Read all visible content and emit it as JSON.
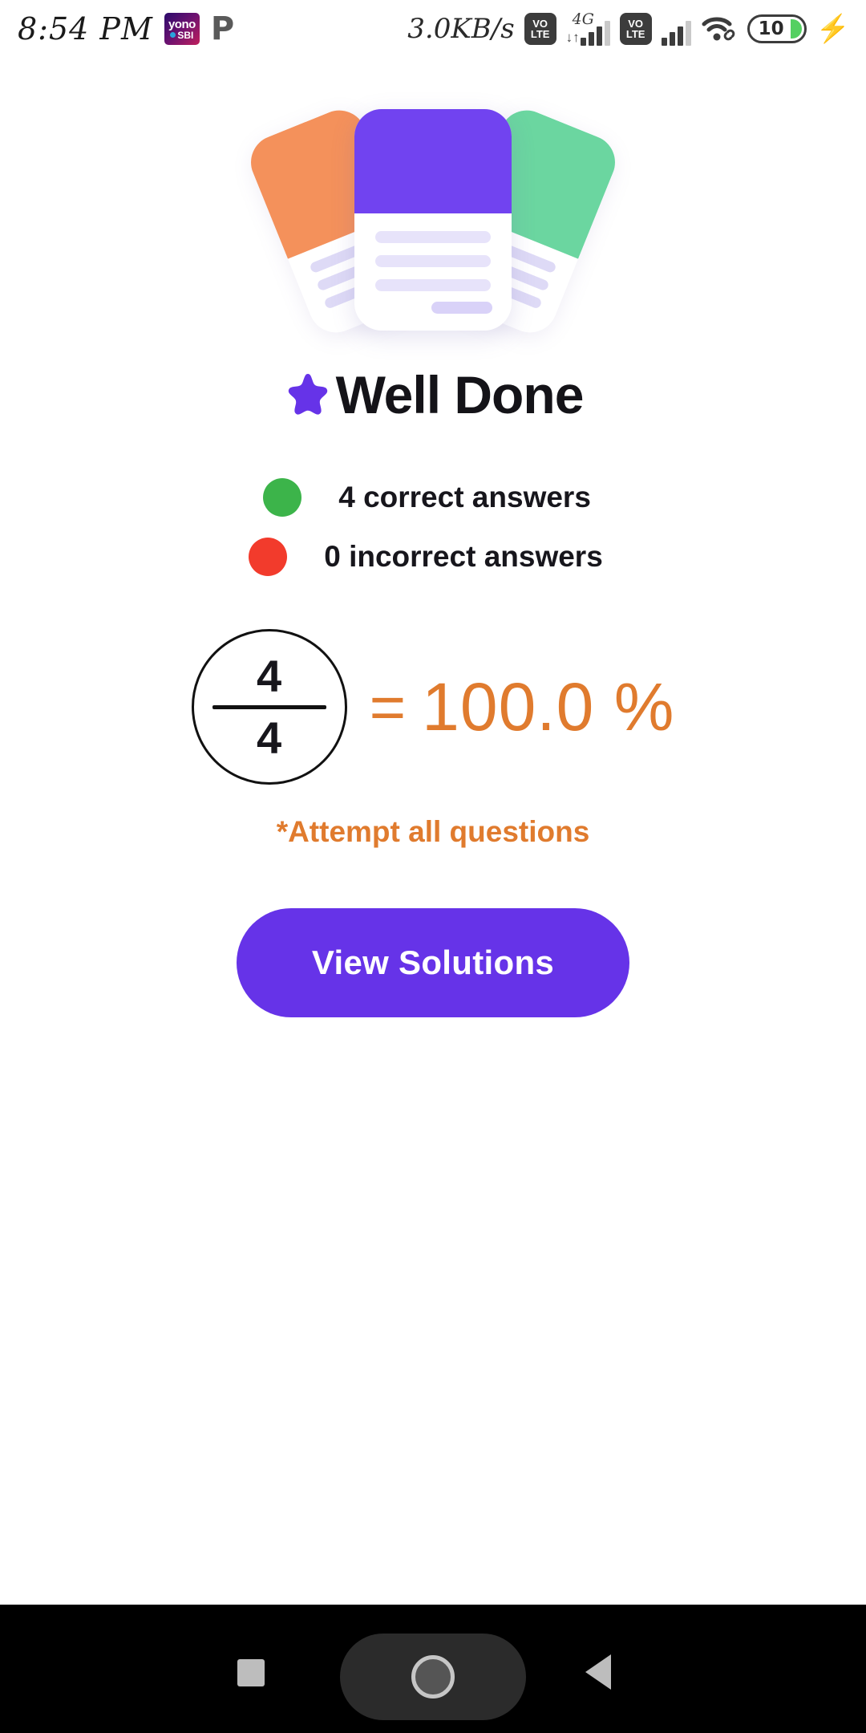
{
  "status_bar": {
    "clock": "8:54 PM",
    "yono_line1": "yono",
    "yono_line2": "SBI",
    "phonepe_glyph": "P",
    "net_speed": "3.0KB/s",
    "volte_top": "VO",
    "volte_bottom": "LTE",
    "network_type": "4G",
    "updown_glyph": "↓↑",
    "battery_level": "10",
    "charging_glyph": "⚡",
    "icons": {
      "yono": "yono-sbi-app-icon",
      "phonepe": "phonepe-app-icon",
      "volte1": "volte-icon",
      "volte2": "volte-icon",
      "signal1": "signal-bars-icon",
      "signal2": "signal-bars-icon",
      "wifi": "wifi-icon",
      "battery": "battery-icon",
      "bolt": "charging-bolt-icon"
    }
  },
  "illustration": {
    "name": "quiz-result-cards-illustration",
    "card_left_color": "#F4915B",
    "card_mid_color": "#7143F0",
    "card_right_color": "#6BD6A0",
    "line_color": "#DEDAF6"
  },
  "result": {
    "star_icon": "star-icon",
    "star_color": "#6633E8",
    "title": "Well Done",
    "stats": [
      {
        "bullet_color": "#3CB44A",
        "label": "4 correct answers",
        "name": "correct-answers-stat"
      },
      {
        "bullet_color": "#F23B2C",
        "label": "0 incorrect answers",
        "name": "incorrect-answers-stat"
      }
    ],
    "score": {
      "numerator": "4",
      "denominator": "4",
      "equals": "=",
      "percentage": "100.0 %",
      "accent_color": "#E07B2E"
    },
    "note": "*Attempt all questions",
    "primary_button": "View Solutions",
    "primary_button_color": "#6633E8"
  },
  "nav_bar": {
    "recents": "recents-square-button",
    "home": "home-circle-button",
    "back": "back-triangle-button"
  }
}
